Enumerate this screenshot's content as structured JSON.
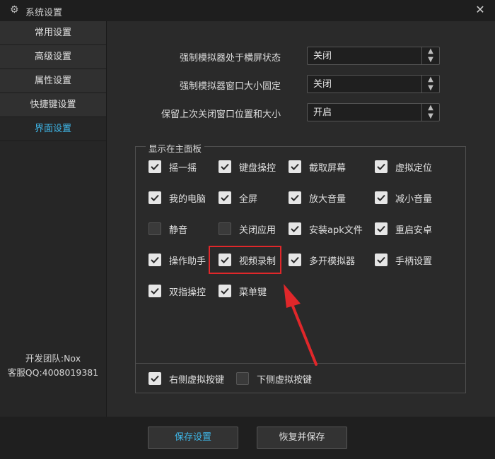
{
  "window": {
    "title": "系统设置"
  },
  "sidebar": {
    "items": [
      {
        "label": "常用设置",
        "active": false
      },
      {
        "label": "高级设置",
        "active": false
      },
      {
        "label": "属性设置",
        "active": false
      },
      {
        "label": "快捷键设置",
        "active": false
      },
      {
        "label": "界面设置",
        "active": true
      }
    ],
    "footer": {
      "team": "开发团队:Nox",
      "qq": "客服QQ:4008019381"
    }
  },
  "settings": [
    {
      "label": "强制模拟器处于横屏状态",
      "value": "关闭"
    },
    {
      "label": "强制模拟器窗口大小固定",
      "value": "关闭"
    },
    {
      "label": "保留上次关闭窗口位置和大小",
      "value": "开启"
    }
  ],
  "panel": {
    "title": "显示在主面板",
    "items": [
      {
        "label": "摇一摇",
        "checked": true
      },
      {
        "label": "键盘操控",
        "checked": true
      },
      {
        "label": "截取屏幕",
        "checked": true
      },
      {
        "label": "虚拟定位",
        "checked": true
      },
      {
        "label": "我的电脑",
        "checked": true
      },
      {
        "label": "全屏",
        "checked": true
      },
      {
        "label": "放大音量",
        "checked": true
      },
      {
        "label": "减小音量",
        "checked": true
      },
      {
        "label": "静音",
        "checked": false
      },
      {
        "label": "关闭应用",
        "checked": false
      },
      {
        "label": "安装apk文件",
        "checked": true
      },
      {
        "label": "重启安卓",
        "checked": true
      },
      {
        "label": "操作助手",
        "checked": true
      },
      {
        "label": "视频录制",
        "checked": true
      },
      {
        "label": "多开模拟器",
        "checked": true
      },
      {
        "label": "手柄设置",
        "checked": true
      },
      {
        "label": "双指操控",
        "checked": true
      },
      {
        "label": "菜单键",
        "checked": true
      }
    ]
  },
  "virtual_keys": [
    {
      "label": "右侧虚拟按键",
      "checked": true
    },
    {
      "label": "下侧虚拟按键",
      "checked": false
    }
  ],
  "buttons": {
    "save": "保存设置",
    "restore": "恢复并保存"
  },
  "colors": {
    "accent": "#3fb8ea",
    "highlight": "#e0272a"
  }
}
